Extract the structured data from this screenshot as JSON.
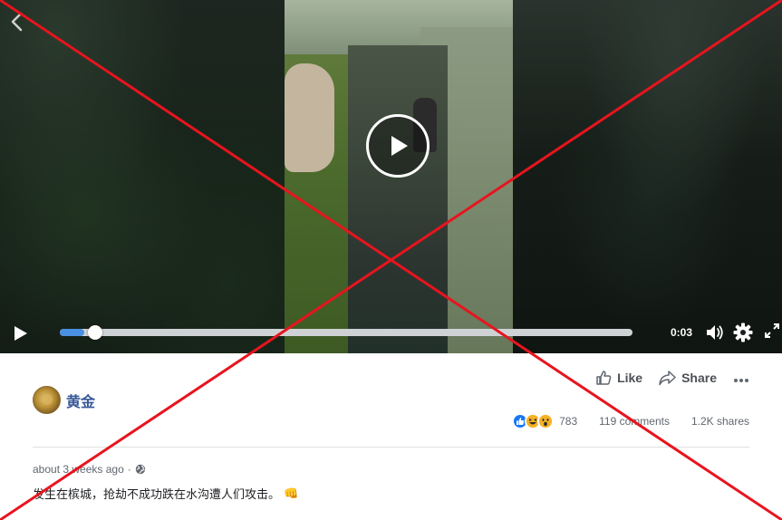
{
  "video": {
    "time": "0:03",
    "progress": 0.03
  },
  "post": {
    "actions": {
      "like_label": "Like",
      "share_label": "Share"
    },
    "author": {
      "name": "黄金"
    },
    "stats": {
      "reaction_count": "783",
      "comments": "119 comments",
      "shares": "1.2K shares",
      "reactions": [
        "like",
        "haha",
        "wow"
      ]
    },
    "meta": {
      "time": "about 3 weeks ago",
      "separator": "·",
      "privacy_icon": "globe-icon"
    },
    "text": "发生在槟城，抢劫不成功跌在水沟遭人们攻击。",
    "text_emoji": "👊"
  },
  "colors": {
    "link": "#385898",
    "progress": "#4a90e2",
    "x_mark": "#e8141e"
  }
}
